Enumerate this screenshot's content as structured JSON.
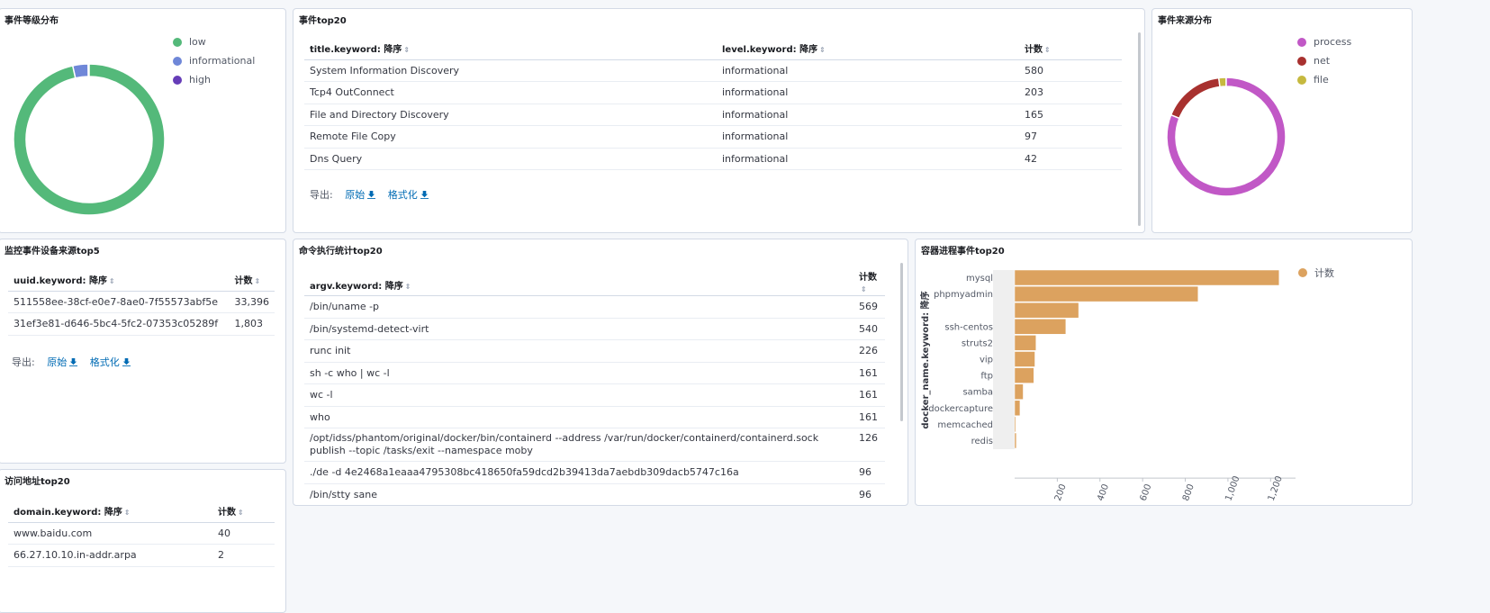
{
  "panels": {
    "level_dist": {
      "title": "事件等级分布",
      "legend": [
        {
          "label": "low",
          "color": "#54b97a"
        },
        {
          "label": "informational",
          "color": "#6f87d8"
        },
        {
          "label": "high",
          "color": "#663db8"
        }
      ],
      "slices": [
        0.965,
        0.033,
        0.002
      ]
    },
    "event_top20": {
      "title": "事件top20",
      "columns": [
        "title.keyword: 降序",
        "level.keyword: 降序",
        "计数"
      ],
      "rows": [
        [
          "System Information Discovery",
          "informational",
          "580"
        ],
        [
          "Tcp4 OutConnect",
          "informational",
          "203"
        ],
        [
          "File and Directory Discovery",
          "informational",
          "165"
        ],
        [
          "Remote File Copy",
          "informational",
          "97"
        ],
        [
          "Dns Query",
          "informational",
          "42"
        ]
      ],
      "export_label": "导出:",
      "export_raw": "原始",
      "export_fmt": "格式化"
    },
    "source_dist": {
      "title": "事件来源分布",
      "legend": [
        {
          "label": "process",
          "color": "#c158c6"
        },
        {
          "label": "net",
          "color": "#a8312f"
        },
        {
          "label": "file",
          "color": "#c6b93f"
        }
      ],
      "slices": [
        0.81,
        0.17,
        0.02
      ]
    },
    "device_top5": {
      "title": "监控事件设备来源top5",
      "columns": [
        "uuid.keyword: 降序",
        "计数"
      ],
      "rows": [
        [
          "511558ee-38cf-e0e7-8ae0-7f55573abf5e",
          "33,396"
        ],
        [
          "31ef3e81-d646-5bc4-5fc2-07353c05289f",
          "1,803"
        ]
      ],
      "export_label": "导出:",
      "export_raw": "原始",
      "export_fmt": "格式化"
    },
    "cmd_top20": {
      "title": "命令执行统计top20",
      "columns": [
        "argv.keyword: 降序",
        "计数"
      ],
      "rows": [
        [
          "/bin/uname -p",
          "569"
        ],
        [
          "/bin/systemd-detect-virt",
          "540"
        ],
        [
          "runc init",
          "226"
        ],
        [
          "sh -c who | wc -l",
          "161"
        ],
        [
          "wc -l",
          "161"
        ],
        [
          "who",
          "161"
        ],
        [
          "/opt/idss/phantom/original/docker/bin/containerd --address /var/run/docker/containerd/containerd.sock publish --topic /tasks/exit --namespace moby",
          "126"
        ],
        [
          "./de -d 4e2468a1eaaa4795308bc418650fa59dcd2b39413da7aebdb309dacb5747c16a",
          "96"
        ],
        [
          "/bin/stty sane",
          "96"
        ]
      ]
    },
    "container_top20": {
      "title": "容器进程事件top20",
      "legend_label": "计数"
    },
    "domain_top20": {
      "title": "访问地址top20",
      "columns": [
        "domain.keyword: 降序",
        "计数"
      ],
      "rows": [
        [
          "www.baidu.com",
          "40"
        ],
        [
          "66.27.10.10.in-addr.arpa",
          "2"
        ]
      ]
    }
  },
  "chart_data": {
    "type": "bar",
    "orientation": "horizontal",
    "categories": [
      "mysql",
      "phpmyadmin",
      "",
      "ssh-centos",
      "struts2",
      "vip",
      "ftp",
      "samba",
      "dockercapture",
      "memcached",
      "redis"
    ],
    "values": [
      1240,
      860,
      300,
      240,
      100,
      95,
      90,
      40,
      25,
      5,
      8
    ],
    "ylabel": "docker_name.keyword: 降序",
    "xlabel": "计数",
    "xticks": [
      "200",
      "400",
      "600",
      "800",
      "1,000",
      "1,200"
    ],
    "xlim": [
      0,
      1300
    ],
    "series_name": "计数",
    "color": "#dca25f"
  }
}
